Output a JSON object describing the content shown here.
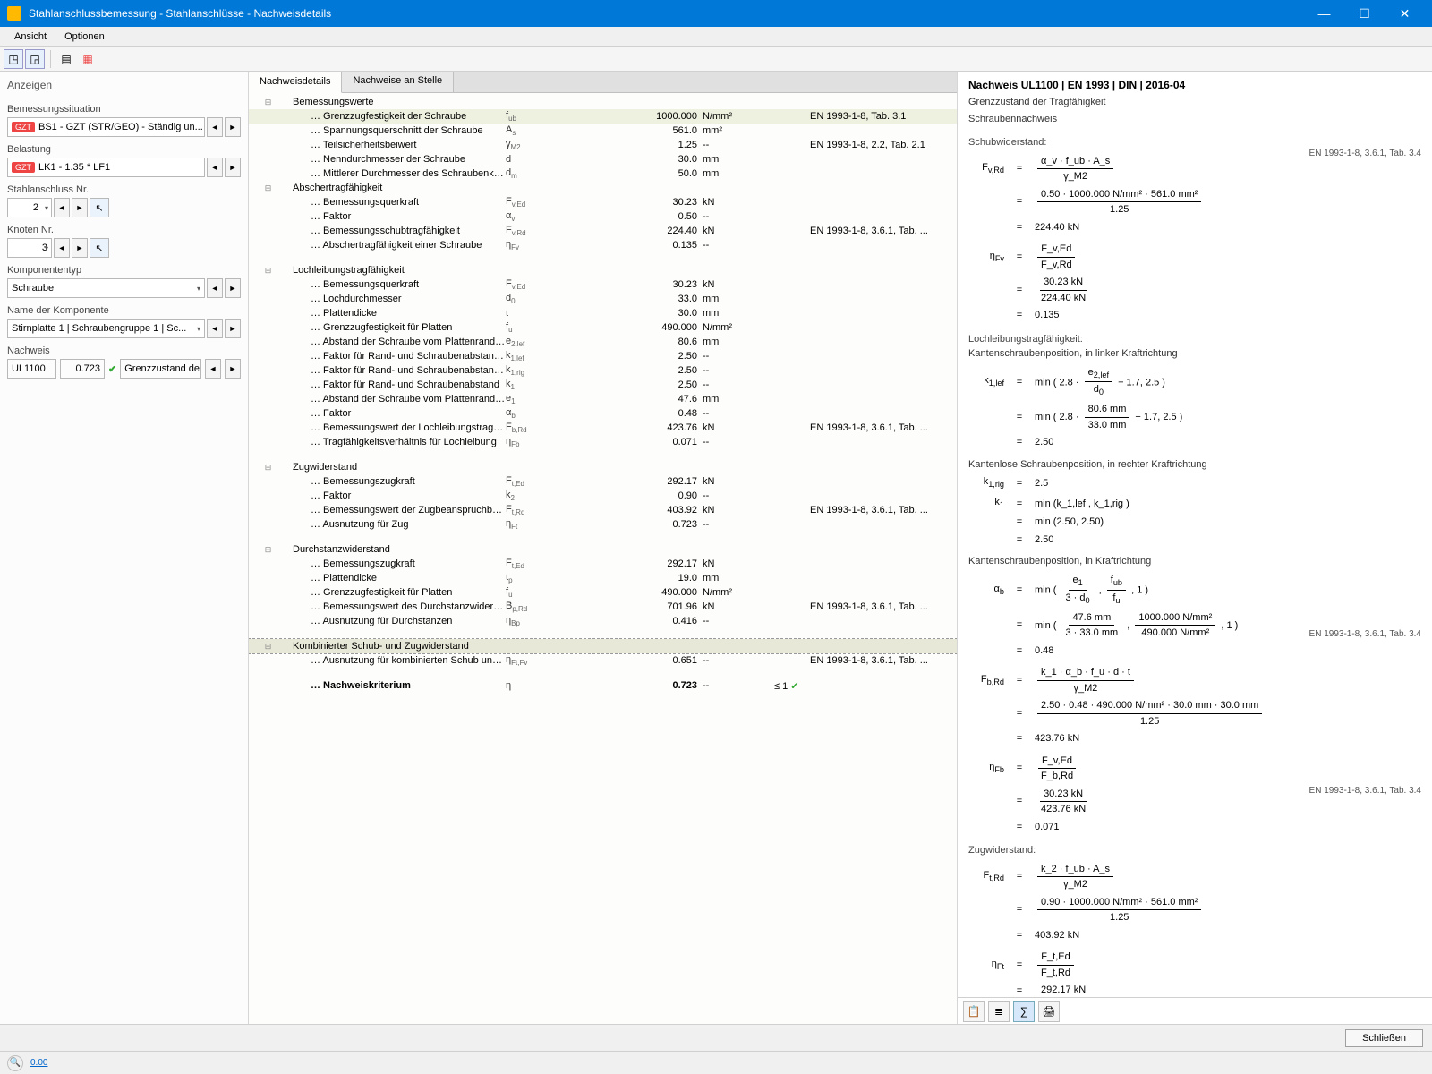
{
  "window": {
    "title": "Stahlanschlussbemessung - Stahlanschlüsse - Nachweisdetails"
  },
  "menu": {
    "ansicht": "Ansicht",
    "optionen": "Optionen"
  },
  "sidebar": {
    "title": "Anzeigen",
    "situation_label": "Bemessungssituation",
    "situation_value": "BS1 - GZT (STR/GEO) - Ständig un...",
    "situation_badge": "GZT",
    "belastung_label": "Belastung",
    "belastung_value": "LK1 - 1.35 * LF1",
    "belastung_badge": "GZT",
    "stahl_label": "Stahlanschluss Nr.",
    "stahl_value": "2",
    "knoten_label": "Knoten Nr.",
    "knoten_value": "3",
    "komptyp_label": "Komponententyp",
    "komptyp_value": "Schraube",
    "kompname_label": "Name der Komponente",
    "kompname_value": "Stirnplatte 1 | Schraubengruppe 1 | Sc...",
    "nachweis_label": "Nachweis",
    "nachweis_code": "UL1100",
    "nachweis_ratio": "0.723",
    "nachweis_desc": "Grenzzustand der Tr..."
  },
  "tabs": {
    "t1": "Nachweisdetails",
    "t2": "Nachweise an Stelle"
  },
  "tree": [
    {
      "t": "g",
      "toggle": "⊟",
      "lbl": "Bemessungswerte"
    },
    {
      "t": "r",
      "lbl": "Grenzzugfestigkeit der Schraube",
      "sym": "f_ub",
      "val": "1000.000",
      "unit": "N/mm²",
      "ref": "EN 1993-1-8, Tab. 3.1",
      "hl": 1
    },
    {
      "t": "r",
      "lbl": "Spannungsquerschnitt der Schraube",
      "sym": "A_s",
      "val": "561.0",
      "unit": "mm²"
    },
    {
      "t": "r",
      "lbl": "Teilsicherheitsbeiwert",
      "sym": "γ_M2",
      "val": "1.25",
      "unit": "--",
      "ref": "EN 1993-1-8, 2.2, Tab. 2.1"
    },
    {
      "t": "r",
      "lbl": "Nenndurchmesser der Schraube",
      "sym": "d",
      "val": "30.0",
      "unit": "mm"
    },
    {
      "t": "r",
      "lbl": "Mittlerer Durchmesser des Schraubenkopfes oder der M...",
      "sym": "d_m",
      "val": "50.0",
      "unit": "mm"
    },
    {
      "t": "g",
      "toggle": "⊟",
      "lbl": "Abschertragfähigkeit"
    },
    {
      "t": "r",
      "lbl": "Bemessungsquerkraft",
      "sym": "F_v,Ed",
      "val": "30.23",
      "unit": "kN"
    },
    {
      "t": "r",
      "lbl": "Faktor",
      "sym": "α_v",
      "val": "0.50",
      "unit": "--"
    },
    {
      "t": "r",
      "lbl": "Bemessungsschubtragfähigkeit",
      "sym": "F_v,Rd",
      "val": "224.40",
      "unit": "kN",
      "ref": "EN 1993-1-8, 3.6.1, Tab. ..."
    },
    {
      "t": "r",
      "lbl": "Abschertragfähigkeit einer Schraube",
      "sym": "η_Fv",
      "val": "0.135",
      "unit": "--"
    },
    {
      "t": "sp"
    },
    {
      "t": "g",
      "toggle": "⊟",
      "lbl": "Lochleibungstragfähigkeit"
    },
    {
      "t": "r",
      "lbl": "Bemessungsquerkraft",
      "sym": "F_v,Ed",
      "val": "30.23",
      "unit": "kN"
    },
    {
      "t": "r",
      "lbl": "Lochdurchmesser",
      "sym": "d_0",
      "val": "33.0",
      "unit": "mm"
    },
    {
      "t": "r",
      "lbl": "Plattendicke",
      "sym": "t",
      "val": "30.0",
      "unit": "mm"
    },
    {
      "t": "r",
      "lbl": "Grenzzugfestigkeit für Platten",
      "sym": "f_u",
      "val": "490.000",
      "unit": "N/mm²"
    },
    {
      "t": "r",
      "lbl": "Abstand der Schraube vom Plattenrand in senkrecht...",
      "sym": "e_2,lef",
      "val": "80.6",
      "unit": "mm"
    },
    {
      "t": "r",
      "lbl": "Faktor für Rand- und Schraubenabstand auf der rec...",
      "sym": "k_1,lef",
      "val": "2.50",
      "unit": "--"
    },
    {
      "t": "r",
      "lbl": "Faktor für Rand- und Schraubenabstand auf der rec...",
      "sym": "k_1,rig",
      "val": "2.50",
      "unit": "--"
    },
    {
      "t": "r",
      "lbl": "Faktor für Rand- und Schraubenabstand",
      "sym": "k_1",
      "val": "2.50",
      "unit": "--"
    },
    {
      "t": "r",
      "lbl": "Abstand der Schraube vom Plattenrand in Richtung ...",
      "sym": "e_1",
      "val": "47.6",
      "unit": "mm"
    },
    {
      "t": "r",
      "lbl": "Faktor",
      "sym": "α_b",
      "val": "0.48",
      "unit": "--"
    },
    {
      "t": "r",
      "lbl": "Bemessungswert der Lochleibungstragfähigkeit",
      "sym": "F_b,Rd",
      "val": "423.76",
      "unit": "kN",
      "ref": "EN 1993-1-8, 3.6.1, Tab. ..."
    },
    {
      "t": "r",
      "lbl": "Tragfähigkeitsverhältnis für Lochleibung",
      "sym": "η_Fb",
      "val": "0.071",
      "unit": "--"
    },
    {
      "t": "sp"
    },
    {
      "t": "g",
      "toggle": "⊟",
      "lbl": "Zugwiderstand"
    },
    {
      "t": "r",
      "lbl": "Bemessungszugkraft",
      "sym": "F_t,Ed",
      "val": "292.17",
      "unit": "kN"
    },
    {
      "t": "r",
      "lbl": "Faktor",
      "sym": "k_2",
      "val": "0.90",
      "unit": "--"
    },
    {
      "t": "r",
      "lbl": "Bemessungswert der Zugbeanspruchbarkeit",
      "sym": "F_t,Rd",
      "val": "403.92",
      "unit": "kN",
      "ref": "EN 1993-1-8, 3.6.1, Tab. ..."
    },
    {
      "t": "r",
      "lbl": "Ausnutzung für Zug",
      "sym": "η_Ft",
      "val": "0.723",
      "unit": "--"
    },
    {
      "t": "sp"
    },
    {
      "t": "g",
      "toggle": "⊟",
      "lbl": "Durchstanzwiderstand"
    },
    {
      "t": "r",
      "lbl": "Bemessungszugkraft",
      "sym": "F_t,Ed",
      "val": "292.17",
      "unit": "kN"
    },
    {
      "t": "r",
      "lbl": "Plattendicke",
      "sym": "t_p",
      "val": "19.0",
      "unit": "mm"
    },
    {
      "t": "r",
      "lbl": "Grenzzugfestigkeit für Platten",
      "sym": "f_u",
      "val": "490.000",
      "unit": "N/mm²"
    },
    {
      "t": "r",
      "lbl": "Bemessungswert des Durchstanzwiderstandes",
      "sym": "B_p,Rd",
      "val": "701.96",
      "unit": "kN",
      "ref": "EN 1993-1-8, 3.6.1, Tab. ..."
    },
    {
      "t": "r",
      "lbl": "Ausnutzung für Durchstanzen",
      "sym": "η_Bp",
      "val": "0.416",
      "unit": "--"
    },
    {
      "t": "sp"
    },
    {
      "t": "g",
      "toggle": "⊟",
      "lbl": "Kombinierter Schub- und Zugwiderstand",
      "sel": 1
    },
    {
      "t": "r",
      "lbl": "Ausnutzung für kombinierten Schub und Zug",
      "sym": "η_Ft,Fv",
      "val": "0.651",
      "unit": "--",
      "ref": "EN 1993-1-8, 3.6.1, Tab. ..."
    },
    {
      "t": "sp"
    },
    {
      "t": "r",
      "lbl": "Nachweiskriterium",
      "sym": "η",
      "val": "0.723",
      "unit": "--",
      "chk": "≤ 1",
      "ok": 1,
      "bold": 1
    }
  ],
  "right": {
    "header": "Nachweis UL1100 | EN 1993 | DIN | 2016-04",
    "line1": "Grenzzustand der Tragfähigkeit",
    "line2": "Schraubennachweis",
    "ref": "EN 1993-1-8, 3.6.1, Tab. 3.4",
    "sec_schub": "Schubwiderstand:",
    "fvrd_num": "α_v · f_ub · A_s",
    "fvrd_den": "γ_M2",
    "fvrd_calc_num": "0.50 · 1000.000 N/mm² · 561.0 mm²",
    "fvrd_calc_den": "1.25",
    "fvrd_res": "224.40 kN",
    "nfv_num": "F_v,Ed",
    "nfv_den": "F_v,Rd",
    "nfv_calc_num": "30.23 kN",
    "nfv_calc_den": "224.40 kN",
    "nfv_res": "0.135",
    "sec_loch": "Lochleibungstragfähigkeit:",
    "loch_sub1": "Kantenschraubenposition, in linker Kraftrichtung",
    "k1lef_expr": "min ( 2.8 · ( e_2,lef / d_0 ) − 1.7, 2.5 )",
    "k1lef_calc": "min ( 2.8 · ( 80.6 mm / 33.0 mm ) − 1.7, 2.5 )",
    "k1lef_res": "2.50",
    "loch_sub2": "Kantenlose Schraubenposition, in rechter Kraftrichtung",
    "k1rig_res": "2.5",
    "k1_expr": "min (k_1,lef , k_1,rig )",
    "k1_calc": "min (2.50, 2.50)",
    "k1_res": "2.50",
    "loch_sub3": "Kantenschraubenposition, in Kraftrichtung",
    "ab_expr": "min ( e_1 / (3 · d_0) , f_ub / f_u , 1 )",
    "ab_calc": "min ( 47.6 mm / (3 · 33.0 mm) , 1000.000 N/mm² / 490.000 N/mm² , 1 )",
    "ab_res": "0.48",
    "fbrd_num": "k_1 · α_b · f_u · d · t",
    "fbrd_den": "γ_M2",
    "fbrd_calc_num": "2.50 · 0.48 · 490.000 N/mm² · 30.0 mm · 30.0 mm",
    "fbrd_calc_den": "1.25",
    "fbrd_res": "423.76 kN",
    "nfb_num": "F_v,Ed",
    "nfb_den": "F_b,Rd",
    "nfb_calc_num": "30.23 kN",
    "nfb_calc_den": "423.76 kN",
    "nfb_res": "0.071",
    "sec_zug": "Zugwiderstand:",
    "ftrd_num": "k_2 · f_ub · A_s",
    "ftrd_den": "γ_M2",
    "ftrd_calc_num": "0.90 · 1000.000 N/mm² · 561.0 mm²",
    "ftrd_calc_den": "1.25",
    "ftrd_res": "403.92 kN",
    "nft_num": "F_t,Ed",
    "nft_den": "F_t,Rd",
    "nft_calc_num": "292.17 kN"
  },
  "footer": {
    "close": "Schließen"
  },
  "status": {
    "val": "0.00"
  }
}
